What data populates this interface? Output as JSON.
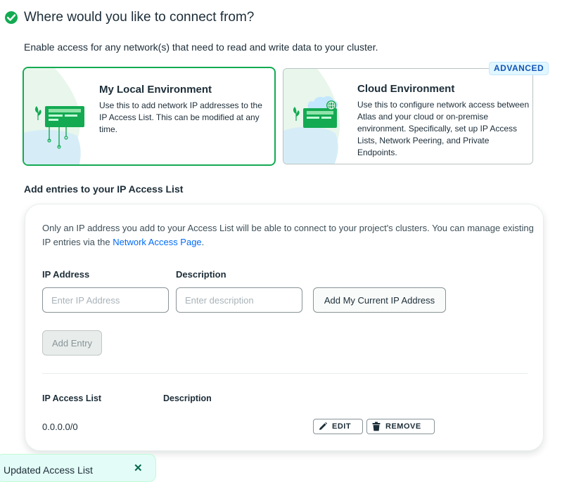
{
  "header": {
    "title": "Where would you like to connect from?",
    "subtitle": "Enable access for any network(s) that need to read and write data to your cluster."
  },
  "environments": {
    "local": {
      "title": "My Local Environment",
      "description": "Use this to add network IP addresses to the IP Access List. This can be modified at any time.",
      "selected": true
    },
    "cloud": {
      "title": "Cloud Environment",
      "description": "Use this to configure network access between Atlas and your cloud or on-premise environment. Specifically, set up IP Access Lists, Network Peering, and Private Endpoints.",
      "badge": "ADVANCED"
    }
  },
  "access_list": {
    "section_title": "Add entries to your IP Access List",
    "info_prefix": "Only an IP address you add to your Access List will be able to connect to your project's clusters. You can manage existing IP entries via the ",
    "info_link": "Network Access Page",
    "info_suffix": ".",
    "ip_label": "IP Address",
    "ip_placeholder": "Enter IP Address",
    "desc_label": "Description",
    "desc_placeholder": "Enter description",
    "add_current_ip_label": "Add My Current IP Address",
    "add_entry_label": "Add Entry",
    "table": {
      "col_ip": "IP Access List",
      "col_desc": "Description",
      "rows": [
        {
          "ip": "0.0.0.0/0",
          "description": "",
          "edit_label": "EDIT",
          "remove_label": "REMOVE"
        }
      ]
    }
  },
  "toast": {
    "text": "Updated Access List",
    "close_icon": "close-icon"
  },
  "colors": {
    "accent_green": "#13aa52",
    "link_blue": "#016bf8",
    "badge_blue": "#1254b7"
  }
}
